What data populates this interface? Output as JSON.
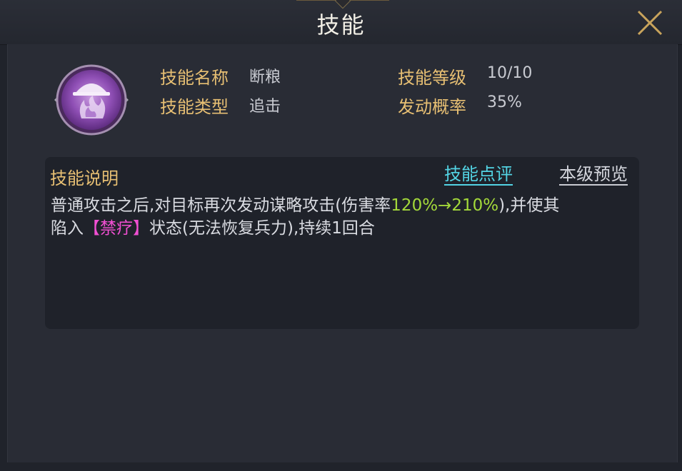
{
  "window": {
    "title": "技能"
  },
  "skill": {
    "icon": "purple-flame-skill-icon",
    "name_label": "技能名称",
    "name_value": "断粮",
    "type_label": "技能类型",
    "type_value": "追击",
    "level_label": "技能等级",
    "level_value": "10/10",
    "rate_label": "发动概率",
    "rate_value": "35%"
  },
  "description": {
    "title": "技能说明",
    "review_link": "技能点评",
    "preview_link": "本级预览",
    "line1_prefix": "普通攻击之后,对目标再次发动谋略攻击(伤害率",
    "damage_rate": "120%→210%",
    "line1_suffix": "),并使其",
    "line2_prefix": "陷入",
    "status_effect": "【禁疗】",
    "line2_suffix": "状态(无法恢复兵力),持续1回合"
  },
  "colors": {
    "label": "#e7bf73",
    "review_link": "#53d4e4",
    "damage_highlight": "#a4d93a",
    "status_highlight": "#f04fd2"
  }
}
